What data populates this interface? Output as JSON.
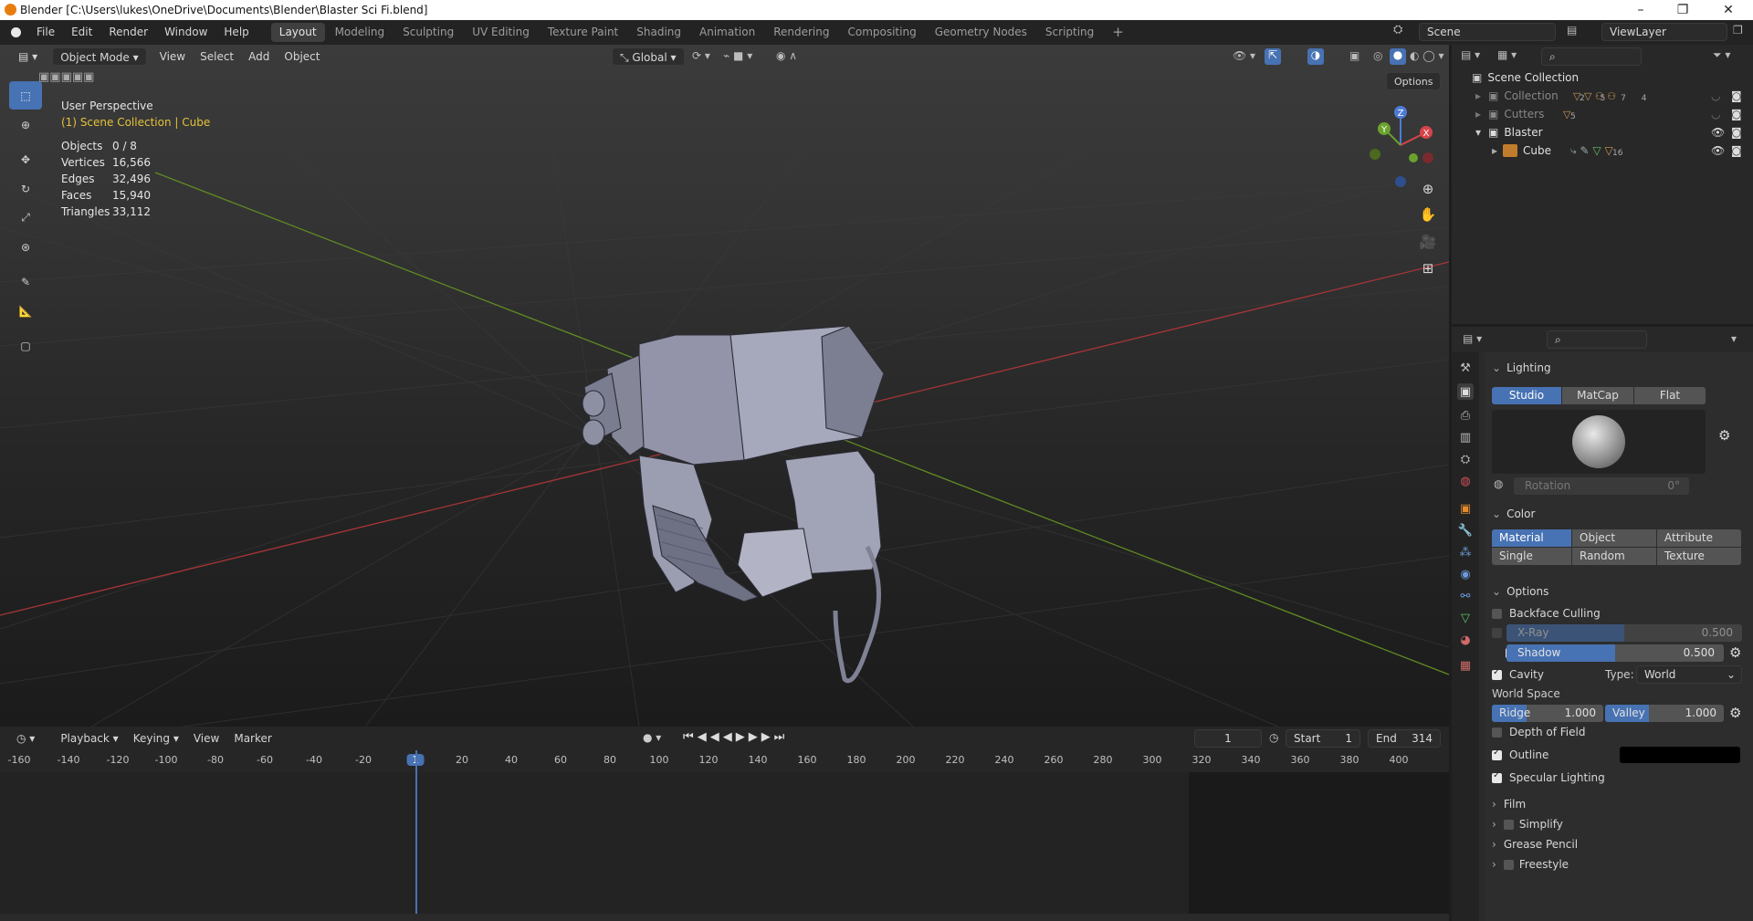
{
  "window": {
    "title": "Blender [C:\\Users\\lukes\\OneDrive\\Documents\\Blender\\Blaster Sci Fi.blend]"
  },
  "menu": [
    "File",
    "Edit",
    "Render",
    "Window",
    "Help"
  ],
  "workspaces": [
    "Layout",
    "Modeling",
    "Sculpting",
    "UV Editing",
    "Texture Paint",
    "Shading",
    "Animation",
    "Rendering",
    "Compositing",
    "Geometry Nodes",
    "Scripting"
  ],
  "scene": {
    "name": "Scene",
    "view_layer": "ViewLayer"
  },
  "viewport": {
    "mode": "Object Mode",
    "menus": [
      "View",
      "Select",
      "Add",
      "Object"
    ],
    "orientation": "Global",
    "options_label": "Options",
    "perspective": "User Perspective",
    "collection_label": "(1) Scene Collection | Cube",
    "stats": [
      {
        "k": "Objects",
        "v": "0 / 8"
      },
      {
        "k": "Vertices",
        "v": "16,566"
      },
      {
        "k": "Edges",
        "v": "32,496"
      },
      {
        "k": "Faces",
        "v": "15,940"
      },
      {
        "k": "Triangles",
        "v": "33,112"
      }
    ],
    "axes": {
      "x": "X",
      "y": "Y",
      "z": "Z"
    }
  },
  "timeline": {
    "menus": [
      "Playback",
      "Keying",
      "View",
      "Marker"
    ],
    "current_frame": "1",
    "start_label": "Start",
    "start": "1",
    "end_label": "End",
    "end": "314",
    "ruler": [
      "-160",
      "-140",
      "-120",
      "-100",
      "-80",
      "-60",
      "-40",
      "-20",
      "1",
      "20",
      "40",
      "60",
      "80",
      "100",
      "120",
      "140",
      "160",
      "180",
      "200",
      "220",
      "240",
      "260",
      "280",
      "300",
      "320",
      "340",
      "360",
      "380",
      "400"
    ]
  },
  "outliner": {
    "root": "Scene Collection",
    "items": [
      {
        "label": "Collection",
        "counts": "2 5 7 4"
      },
      {
        "label": "Cutters",
        "counts": "5"
      },
      {
        "label": "Blaster",
        "counts": ""
      },
      {
        "label": "Cube",
        "counts": "16"
      }
    ]
  },
  "properties": {
    "lighting": {
      "title": "Lighting",
      "modes": [
        "Studio",
        "MatCap",
        "Flat"
      ],
      "rotation_label": "Rotation",
      "rotation_value": "0°"
    },
    "color": {
      "title": "Color",
      "options": [
        "Material",
        "Object",
        "Attribute",
        "Single",
        "Random",
        "Texture"
      ]
    },
    "options": {
      "title": "Options",
      "backface": "Backface Culling",
      "xray": "X-Ray",
      "xray_value": "0.500",
      "shadow": "Shadow",
      "shadow_value": "0.500",
      "cavity": "Cavity",
      "type_label": "Type:",
      "type_value": "World",
      "world_space": "World Space",
      "ridge": "Ridge",
      "ridge_value": "1.000",
      "valley": "Valley",
      "valley_value": "1.000",
      "dof": "Depth of Field",
      "outline": "Outline",
      "specular": "Specular Lighting"
    },
    "sections": [
      "Film",
      "Simplify",
      "Grease Pencil",
      "Freestyle"
    ]
  },
  "colors": {
    "accent": "#4772b3",
    "x_axis": "#c2393b",
    "y_axis": "#6a9a26"
  }
}
